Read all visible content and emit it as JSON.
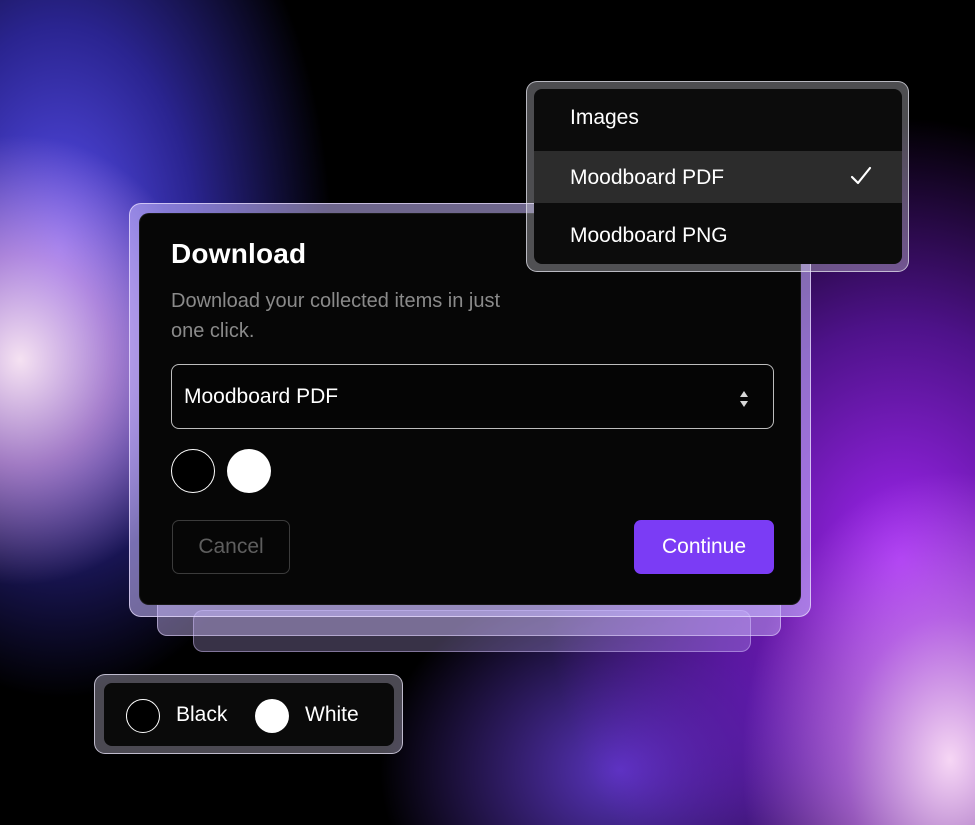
{
  "dialog": {
    "title": "Download",
    "description": "Download your collected items in just one click.",
    "select": {
      "value": "Moodboard PDF",
      "icon": "chevron-up-down-icon"
    },
    "color_options": [
      {
        "name": "black",
        "color": "#000000"
      },
      {
        "name": "white",
        "color": "#ffffff"
      }
    ],
    "cancel_label": "Cancel",
    "continue_label": "Continue"
  },
  "dropdown": {
    "items": [
      {
        "label": "Images",
        "selected": false
      },
      {
        "label": "Moodboard PDF",
        "selected": true
      },
      {
        "label": "Moodboard PNG",
        "selected": false
      }
    ],
    "selected_icon": "check-icon"
  },
  "legend": {
    "items": [
      {
        "label": "Black",
        "color": "#000000"
      },
      {
        "label": "White",
        "color": "#ffffff"
      }
    ]
  },
  "colors": {
    "accent": "#7b3cf5",
    "dialog_background": "#060606",
    "muted_text": "#8a8a8a"
  }
}
